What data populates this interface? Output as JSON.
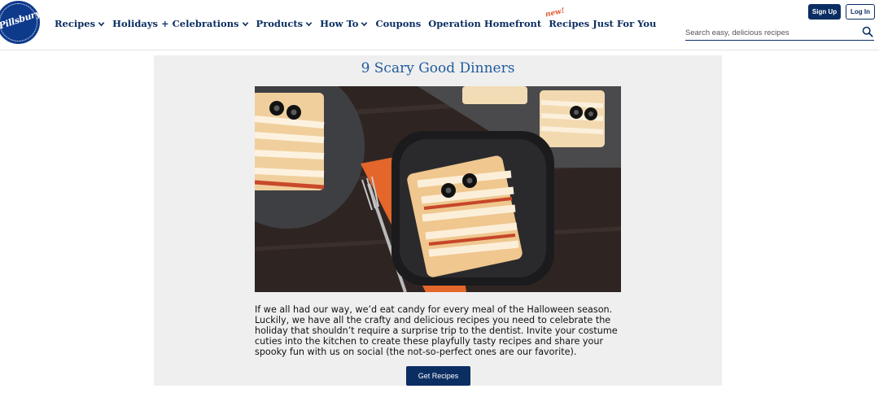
{
  "brand": {
    "logo_text": "Pillsbury"
  },
  "nav": {
    "items": [
      {
        "label": "Recipes",
        "dropdown": true
      },
      {
        "label": "Holidays + Celebrations",
        "dropdown": true
      },
      {
        "label": "Products",
        "dropdown": true
      },
      {
        "label": "How To",
        "dropdown": true
      },
      {
        "label": "Coupons",
        "dropdown": false
      },
      {
        "label": "Operation Homefront",
        "dropdown": false
      },
      {
        "label": "Recipes Just For You",
        "dropdown": false,
        "badge": "new!"
      }
    ]
  },
  "account": {
    "signup_label": "Sign Up",
    "login_label": "Log In"
  },
  "search": {
    "placeholder": "Search easy, delicious recipes",
    "icon": "search-icon"
  },
  "feature": {
    "title": "9 Scary Good Dinners",
    "image_alt": "Mummy pizza squares with olive eyes on dark plates",
    "description": "If we all had our way, we’d eat candy for every meal of the Halloween season. Luckily, we have all the crafty and delicious recipes you need to celebrate the holiday that shouldn’t require a surprise trip to the dentist. Invite your costume cuties into the kitchen to create these playfully tasty recipes and share your spooky fun with us on social (the not-so-perfect ones are our favorite).",
    "cta_label": "Get Recipes"
  },
  "colors": {
    "navy": "#0b2e62",
    "title_blue": "#1f5c9e",
    "badge_orange": "#e4572e",
    "panel_bg": "#efefef"
  }
}
